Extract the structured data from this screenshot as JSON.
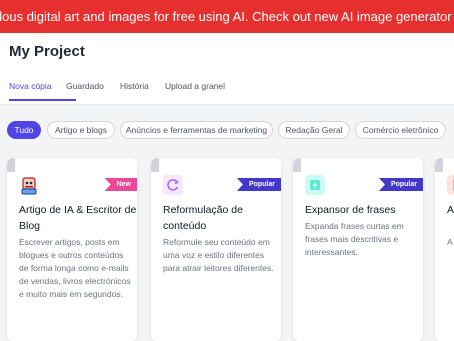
{
  "promo": {
    "text": "ulous digital art and images for free using AI. Check out new AI image generator - Photosonic!"
  },
  "header": {
    "title": "My Project",
    "tabs": [
      "Nova cópia",
      "Guardado",
      "História",
      "Upload a granel"
    ]
  },
  "filters": [
    "Tudo",
    "Artigo e blogs",
    "Anúncios e ferramentas de marketing",
    "Redação Geral",
    "Comércio eletrônico"
  ],
  "colors": {
    "accent": "#4f46e5",
    "promo": "#e5302f",
    "badge_new": "#ec4899",
    "badge_popular": "#4338ca"
  },
  "cards": [
    {
      "icon": "writer-avatar-icon",
      "badge": "New",
      "title": "Artigo de IA & Escritor de Blog",
      "description": "Escrever artigos, posts em blogues e outros conteúdos de forma longa como e-mails de vendas, livros electrónicos e muito mais em segundos."
    },
    {
      "icon": "refresh-icon",
      "badge": "Popular",
      "title": "Reformulação de conteúdo",
      "description": "Reformule seu conteúdo em uma voz e estilo diferentes para atrair leitores diferentes."
    },
    {
      "icon": "expand-icon",
      "badge": "Popular",
      "title": "Expansor de frases",
      "description": "Expanda frases curtas em frases mais descritivas e interessantes."
    },
    {
      "icon": "document-icon",
      "badge": "",
      "title": "A F",
      "description": "A F"
    }
  ]
}
